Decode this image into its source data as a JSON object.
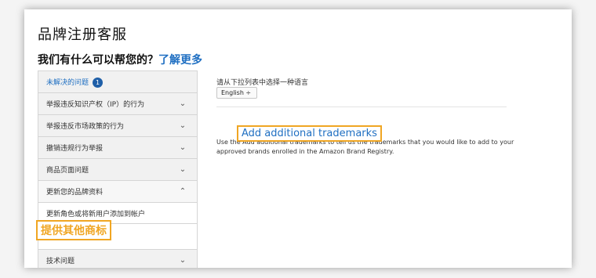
{
  "header": {
    "title": "品牌注册客服",
    "help_prefix": "我们有什么可以帮您的？",
    "help_link": "了解更多"
  },
  "sidebar": {
    "items": [
      {
        "label": "未解决的问题",
        "badge": "1"
      },
      {
        "label": "举报违反知识产权（IP）的行为"
      },
      {
        "label": "举报违反市场政策的行为"
      },
      {
        "label": "撤销违规行为举报"
      },
      {
        "label": "商品页面问题"
      },
      {
        "label": "更新您的品牌资料"
      },
      {
        "label": "更新角色或将新用户添加到帐户"
      },
      {
        "label": "技术问题"
      }
    ]
  },
  "main": {
    "language_label": "请从下拉列表中选择一种语言",
    "language_value": "English ÷",
    "para_line1": "Use the Add additional trademarks to tell us the trademarks that you would like to add to your",
    "para_line2": "approved brands enrolled in the Amazon Brand Registry."
  },
  "highlights": {
    "link_text": "Add additional trademarks",
    "sidebar_text": "提供其他商标",
    "color": "#f0a623"
  },
  "colors": {
    "link": "#1f6fc2",
    "badge": "#1f5fa8"
  }
}
